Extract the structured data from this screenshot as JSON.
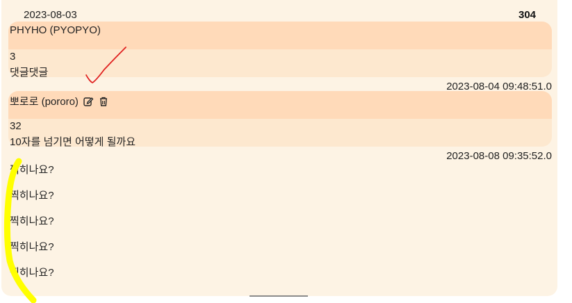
{
  "post": {
    "date": "2023-08-03",
    "count": "304"
  },
  "comments": [
    {
      "author": "PHYHO (PYOPYO)",
      "likes": "3",
      "text": "댓글댓글",
      "timestamp": "2023-08-04 09:48:51.0"
    },
    {
      "author": "뽀로로 (pororo)",
      "likes": "32",
      "text": "10자를 넘기면 어떻게 될까요",
      "timestamp": "2023-08-08 09:35:52.0",
      "edit_icon": "edit-icon",
      "delete_icon": "trash-icon"
    }
  ],
  "body_lines": [
    "찍히나요?",
    "찍히나요?",
    "찍히나요?",
    "찍히나요?",
    "찍히나요?"
  ],
  "colors": {
    "panel_bg": "#fdf3e4",
    "comment_head_bg": "#ffdab9",
    "comment_body_bg": "#fde8cf",
    "annotation_red": "#e0201f",
    "annotation_yellow": "#ffff00"
  }
}
